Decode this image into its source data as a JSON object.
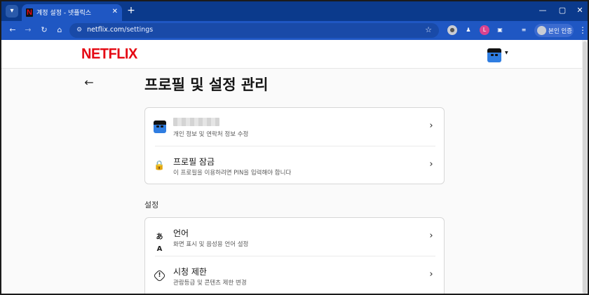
{
  "browser": {
    "tab_title": "계정 설정 - 넷플릭스",
    "tab_close": "✕",
    "new_tab": "+",
    "url_host": "netflix.com",
    "url_path": "/settings",
    "profile_chip_label": "본인 인증",
    "window_controls": {
      "minimize": "—",
      "maximize": "▢",
      "close": "✕"
    },
    "toolbar_icons": {
      "back": "←",
      "forward": "→",
      "reload": "↻",
      "home": "⌂",
      "site_info": "⚙",
      "star": "☆",
      "menu": "⋮"
    },
    "extensions": {
      "ext_a": "●",
      "ext_b": "♟",
      "ext_c": "L",
      "ext_d": "▣",
      "media": "≡"
    }
  },
  "site": {
    "logo": "NETFLIX",
    "header_caret": "▼"
  },
  "page": {
    "back_icon": "←",
    "title": "프로필 및 설정 관리",
    "profile_card": {
      "row1_sub": "개인 정보 및 연락처 정보 수정",
      "row2_title": "프로필 잠금",
      "row2_sub": "이 프로필을 이용하려면 PIN을 입력해야 합니다",
      "lock_icon": "🔒",
      "chevron": "›"
    },
    "section_label": "설정",
    "settings_card": {
      "rows": [
        {
          "title": "언어",
          "sub": "화면 표시 및 음성용 언어 설정",
          "icon": "あA"
        },
        {
          "title": "시청 제한",
          "sub": "관람등급 및 콘텐츠 제한 변경",
          "icon": "!"
        }
      ],
      "chevron": "›"
    }
  },
  "colors": {
    "brand": "#e50914",
    "chrome_tabbar": "#0b3a8c",
    "chrome_toolbar": "#1f57c3"
  }
}
